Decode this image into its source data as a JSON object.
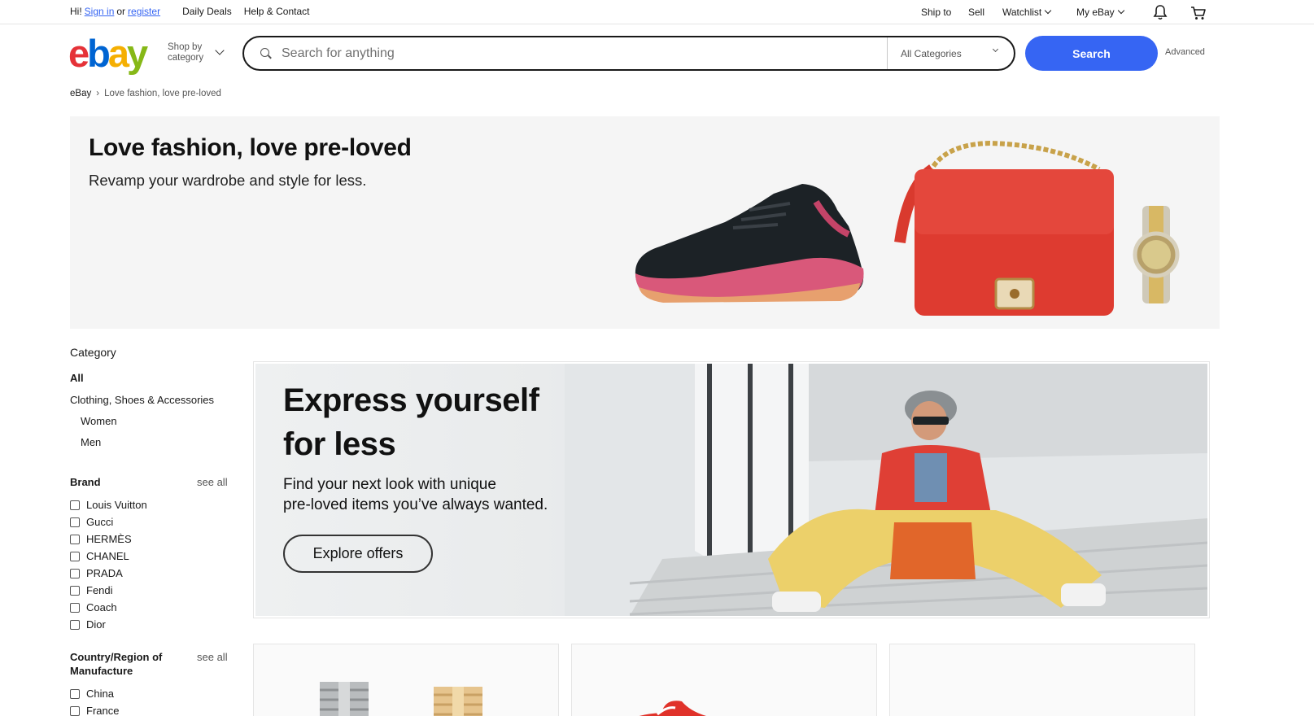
{
  "topbar": {
    "greeting": "Hi!",
    "sign_in": "Sign in",
    "or": "or",
    "register": "register",
    "daily_deals": "Daily Deals",
    "help_contact": "Help & Contact",
    "ship_to": "Ship to",
    "sell": "Sell",
    "watchlist": "Watchlist",
    "my_ebay": "My eBay",
    "bell_icon": "bell-icon",
    "cart_icon": "cart-icon"
  },
  "header": {
    "logo": {
      "e": "e",
      "b": "b",
      "a": "a",
      "y": "y"
    },
    "shop_by_line1": "Shop by",
    "shop_by_line2": "category",
    "search_placeholder": "Search for anything",
    "search_value": "",
    "category_selected": "All Categories",
    "search_button": "Search",
    "advanced": "Advanced"
  },
  "breadcrumb": {
    "items": [
      "eBay",
      "Love fashion, love pre-loved"
    ]
  },
  "hero": {
    "title": "Love fashion, love pre-loved",
    "subtitle": "Revamp your wardrobe and style for less."
  },
  "sidebar": {
    "category_heading": "Category",
    "category_items": [
      "All",
      "Clothing, Shoes & Accessories",
      "Women",
      "Men"
    ],
    "brand_heading": "Brand",
    "brand_see_all": "see all",
    "brands": [
      "Louis Vuitton",
      "Gucci",
      "HERMÈS",
      "CHANEL",
      "PRADA",
      "Fendi",
      "Coach",
      "Dior"
    ],
    "country_heading_line1": "Country/Region of",
    "country_heading_line2": "Manufacture",
    "country_see_all": "see all",
    "countries": [
      "China",
      "France"
    ]
  },
  "promo": {
    "title_line1": "Express yourself",
    "title_line2": "for less",
    "desc_line1": "Find your next look with unique",
    "desc_line2": "pre-loved items you’ve always wanted.",
    "cta": "Explore offers"
  },
  "colors": {
    "accent": "#3665f3",
    "logo_e": "#e53238",
    "logo_b": "#0064d2",
    "logo_a": "#f5af02",
    "logo_y": "#86b817"
  }
}
